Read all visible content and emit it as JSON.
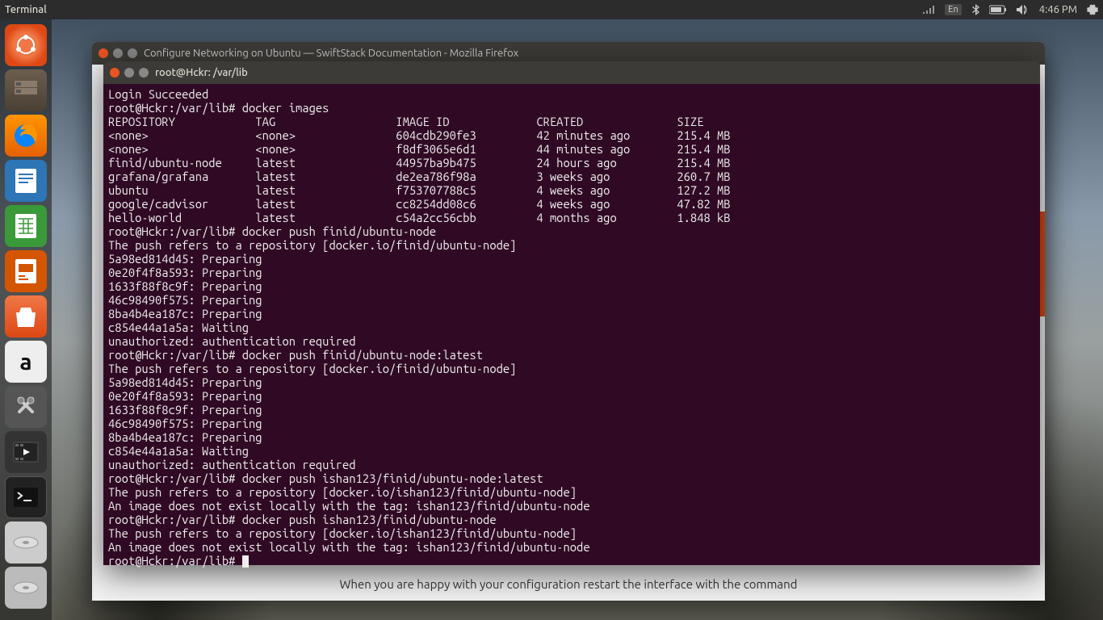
{
  "topbar": {
    "title": "Terminal",
    "lang": "En",
    "time": "4:46 PM"
  },
  "firefox": {
    "title": "Configure Networking on Ubuntu — SwiftStack Documentation - Mozilla Firefox",
    "footer_text": "When you are happy with your configuration restart the interface with the command"
  },
  "terminal": {
    "title": "root@Hckr: /var/lib",
    "lines": [
      "Login Succeeded",
      "root@Hckr:/var/lib# docker images",
      "REPOSITORY            TAG                  IMAGE ID             CREATED              SIZE",
      "<none>                <none>               604cdb290fe3         42 minutes ago       215.4 MB",
      "<none>                <none>               f8df3065e6d1         44 minutes ago       215.4 MB",
      "finid/ubuntu-node     latest               44957ba9b475         24 hours ago         215.4 MB",
      "grafana/grafana       latest               de2ea786f98a         3 weeks ago          260.7 MB",
      "ubuntu                latest               f753707788c5         4 weeks ago          127.2 MB",
      "google/cadvisor       latest               cc8254dd08c6         4 weeks ago          47.82 MB",
      "hello-world           latest               c54a2cc56cbb         4 months ago         1.848 kB",
      "root@Hckr:/var/lib# docker push finid/ubuntu-node",
      "The push refers to a repository [docker.io/finid/ubuntu-node]",
      "5a98ed814d45: Preparing",
      "0e20f4f8a593: Preparing",
      "1633f88f8c9f: Preparing",
      "46c98490f575: Preparing",
      "8ba4b4ea187c: Preparing",
      "c854e44a1a5a: Waiting",
      "unauthorized: authentication required",
      "root@Hckr:/var/lib# docker push finid/ubuntu-node:latest",
      "The push refers to a repository [docker.io/finid/ubuntu-node]",
      "5a98ed814d45: Preparing",
      "0e20f4f8a593: Preparing",
      "1633f88f8c9f: Preparing",
      "46c98490f575: Preparing",
      "8ba4b4ea187c: Preparing",
      "c854e44a1a5a: Waiting",
      "unauthorized: authentication required",
      "root@Hckr:/var/lib# docker push ishan123/finid/ubuntu-node:latest",
      "The push refers to a repository [docker.io/ishan123/finid/ubuntu-node]",
      "An image does not exist locally with the tag: ishan123/finid/ubuntu-node",
      "root@Hckr:/var/lib# docker push ishan123/finid/ubuntu-node",
      "The push refers to a repository [docker.io/ishan123/finid/ubuntu-node]",
      "An image does not exist locally with the tag: ishan123/finid/ubuntu-node",
      "root@Hckr:/var/lib# "
    ]
  }
}
